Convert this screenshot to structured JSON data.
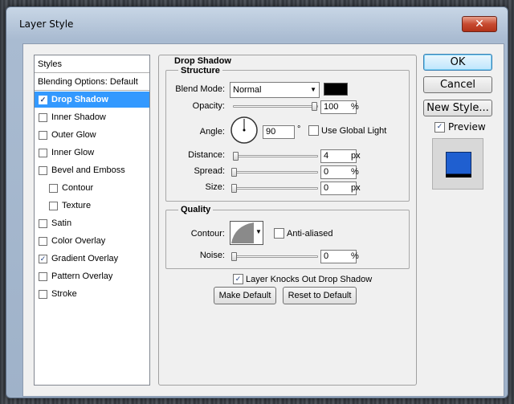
{
  "window": {
    "title": "Layer Style",
    "close_glyph": "✕"
  },
  "styles_list": {
    "header": "Styles",
    "blending": "Blending Options: Default",
    "items": [
      {
        "label": "Drop Shadow",
        "checked": true,
        "selected": true,
        "indent": false
      },
      {
        "label": "Inner Shadow",
        "checked": false,
        "selected": false,
        "indent": false
      },
      {
        "label": "Outer Glow",
        "checked": false,
        "selected": false,
        "indent": false
      },
      {
        "label": "Inner Glow",
        "checked": false,
        "selected": false,
        "indent": false
      },
      {
        "label": "Bevel and Emboss",
        "checked": false,
        "selected": false,
        "indent": false
      },
      {
        "label": "Contour",
        "checked": false,
        "selected": false,
        "indent": true
      },
      {
        "label": "Texture",
        "checked": false,
        "selected": false,
        "indent": true
      },
      {
        "label": "Satin",
        "checked": false,
        "selected": false,
        "indent": false
      },
      {
        "label": "Color Overlay",
        "checked": false,
        "selected": false,
        "indent": false
      },
      {
        "label": "Gradient Overlay",
        "checked": true,
        "selected": false,
        "indent": false
      },
      {
        "label": "Pattern Overlay",
        "checked": false,
        "selected": false,
        "indent": false
      },
      {
        "label": "Stroke",
        "checked": false,
        "selected": false,
        "indent": false
      }
    ]
  },
  "drop_shadow": {
    "title": "Drop Shadow",
    "structure": {
      "title": "Structure",
      "blend_mode_label": "Blend Mode:",
      "blend_mode_value": "Normal",
      "shadow_color": "#000000",
      "opacity_label": "Opacity:",
      "opacity_value": "100",
      "opacity_unit": "%",
      "opacity_level": 1.0,
      "angle_label": "Angle:",
      "angle_value": "90",
      "angle_unit": "°",
      "use_global_light_label": "Use Global Light",
      "use_global_light_checked": false,
      "distance_label": "Distance:",
      "distance_value": "4",
      "distance_unit": "px",
      "distance_level": 0.02,
      "spread_label": "Spread:",
      "spread_value": "0",
      "spread_unit": "%",
      "spread_level": 0,
      "size_label": "Size:",
      "size_value": "0",
      "size_unit": "px",
      "size_level": 0
    },
    "quality": {
      "title": "Quality",
      "contour_label": "Contour:",
      "anti_aliased_label": "Anti-aliased",
      "anti_aliased_checked": false,
      "noise_label": "Noise:",
      "noise_value": "0",
      "noise_unit": "%",
      "noise_level": 0
    },
    "knocks_out_label": "Layer Knocks Out Drop Shadow",
    "knocks_out_checked": true,
    "make_default_label": "Make Default",
    "reset_default_label": "Reset to Default"
  },
  "buttons": {
    "ok": "OK",
    "cancel": "Cancel",
    "new_style": "New Style..."
  },
  "preview": {
    "label": "Preview",
    "checked": true,
    "swatch_color": "#1f5fd0"
  },
  "colors": {
    "selection": "#3399ff",
    "dialog_bg": "#f0f0f0"
  },
  "icons": {
    "check": "✓",
    "dropdown": "▼"
  }
}
